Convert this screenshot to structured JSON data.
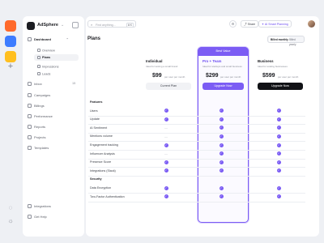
{
  "app": {
    "name": "AdSphere",
    "logo_icon": "adsphere-logo-icon"
  },
  "colors": {
    "accent": "#7b5cf4",
    "rail_orange": "#ff6a2b",
    "rail_blue": "#3d7cff",
    "rail_yellow": "#ffbf1f",
    "dark": "#1c1d22"
  },
  "sidebar": {
    "items": [
      {
        "label": "Dashboard",
        "icon": "dashboard-icon",
        "active": true
      },
      {
        "label": "Inbox",
        "icon": "inbox-icon",
        "count": "15"
      },
      {
        "label": "Campaigns",
        "icon": "megaphone-icon"
      },
      {
        "label": "Billings",
        "icon": "card-icon"
      },
      {
        "label": "Performance",
        "icon": "chart-icon"
      },
      {
        "label": "Reports",
        "icon": "report-icon"
      },
      {
        "label": "Projects",
        "icon": "folder-icon"
      },
      {
        "label": "Templates",
        "icon": "template-icon"
      }
    ],
    "sub_items": [
      {
        "label": "Overview",
        "icon": "grid-icon"
      },
      {
        "label": "Plans",
        "icon": "layers-icon",
        "active": true
      },
      {
        "label": "Impressions",
        "icon": "eye-icon"
      },
      {
        "label": "Leads",
        "icon": "user-icon"
      }
    ],
    "footer": [
      {
        "label": "Integrations",
        "icon": "plug-icon"
      },
      {
        "label": "Get Help",
        "icon": "help-icon"
      }
    ]
  },
  "topbar": {
    "search_placeholder": "Find anything...",
    "search_kbd": "⌘K",
    "share_label": "Share",
    "smart_planning_label": "AI Smart Planning"
  },
  "page": {
    "title": "Plans",
    "billing_toggle": {
      "options": [
        "Billed monthly",
        "Billed yearly"
      ],
      "selected": "Billed monthly"
    }
  },
  "plans": [
    {
      "name": "Individual",
      "desc": "Ideal for testing a small brand",
      "price": "$99",
      "period": "per user per month",
      "button": "Current Plan"
    },
    {
      "name": "Pro + Team",
      "desc": "Ideal for startups and small business",
      "price": "$299",
      "period": "per user per month",
      "button": "Upgrade Now",
      "badge": "Best Value"
    },
    {
      "name": "Business",
      "desc": "Ideal for scaling businesses",
      "price": "$599",
      "period": "per user per month",
      "button": "Upgrade Now"
    }
  ],
  "features": [
    {
      "label": "Features",
      "section": true
    },
    {
      "label": "Users",
      "values": [
        "check",
        "check",
        "check"
      ]
    },
    {
      "label": "Update",
      "values": [
        "check",
        "check",
        "check"
      ]
    },
    {
      "label": "AI Sentiment",
      "values": [
        "dash",
        "check",
        "check"
      ]
    },
    {
      "label": "Mentions volume",
      "values": [
        "dash",
        "check",
        "check"
      ]
    },
    {
      "label": "Engagement tracking",
      "values": [
        "check",
        "check",
        "check"
      ]
    },
    {
      "label": "Influencer Analysis",
      "values": [
        "dash",
        "check",
        "check"
      ]
    },
    {
      "label": "Presence Score",
      "values": [
        "check",
        "check",
        "check"
      ]
    },
    {
      "label": "Integrations (Slack)",
      "values": [
        "check",
        "check",
        "check"
      ]
    },
    {
      "label": "Security",
      "section": true
    },
    {
      "label": "Data Encryption",
      "values": [
        "check",
        "check",
        "check"
      ]
    },
    {
      "label": "Two-Factor Authentication",
      "values": [
        "check",
        "check",
        "check"
      ]
    }
  ]
}
